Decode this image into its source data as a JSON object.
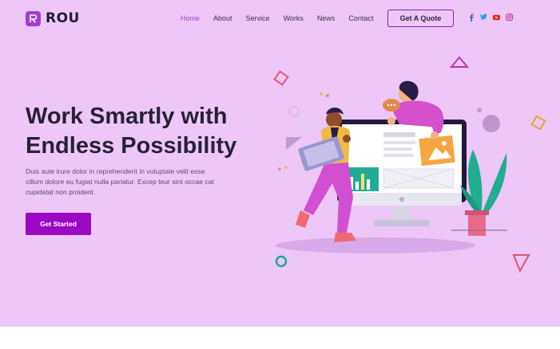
{
  "brand": {
    "name": "ROU"
  },
  "nav": {
    "items": [
      {
        "label": "Home",
        "active": true
      },
      {
        "label": "About"
      },
      {
        "label": "Service"
      },
      {
        "label": "Works"
      },
      {
        "label": "News"
      },
      {
        "label": "Contact"
      }
    ],
    "quote_label": "Get A Quote"
  },
  "socials": [
    "facebook-icon",
    "twitter-icon",
    "youtube-icon",
    "instagram-icon"
  ],
  "hero": {
    "headline_line1": "Work Smartly with",
    "headline_line2": "Endless Possibility",
    "lead": "Duis aute irure dolor in reprehenderit in voluptate velit esse cillum dolore eu fugiat nulla pariatur. Excep teur sint occae cat cupidatat non proident.",
    "cta_label": "Get Started"
  },
  "colors": {
    "background": "#ecc7f7",
    "accent": "#9c07c3",
    "nav_active": "#a63fd1",
    "text": "#262234"
  }
}
